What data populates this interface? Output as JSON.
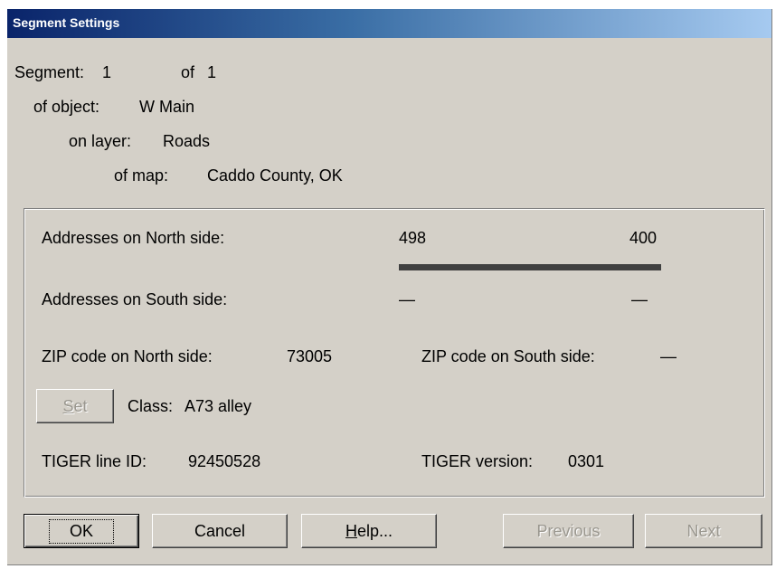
{
  "window": {
    "title": "Segment Settings"
  },
  "segment": {
    "label": "Segment:",
    "number": "1",
    "of_label": "of",
    "total": "1",
    "object_label": "of object:",
    "object_value": "W Main",
    "layer_label": "on layer:",
    "layer_value": "Roads",
    "map_label": "of map:",
    "map_value": "Caddo County, OK"
  },
  "addresses": {
    "north_label": "Addresses on North side:",
    "north_from": "498",
    "north_to": "400",
    "south_label": "Addresses on South side:",
    "south_from": "—",
    "south_to": "—"
  },
  "zip": {
    "north_label": "ZIP code on North side:",
    "north_value": "73005",
    "south_label": "ZIP code on South side:",
    "south_value": "—"
  },
  "set_button": {
    "label_first": "S",
    "label_rest": "et"
  },
  "class": {
    "label": "Class:",
    "value": "A73 alley"
  },
  "tiger": {
    "id_label": "TIGER line ID:",
    "id_value": "92450528",
    "version_label": "TIGER version:",
    "version_value": "0301"
  },
  "buttons": {
    "ok": "OK",
    "cancel": "Cancel",
    "help_first": "H",
    "help_rest": "elp...",
    "previous": "Previous",
    "next": "Next"
  }
}
